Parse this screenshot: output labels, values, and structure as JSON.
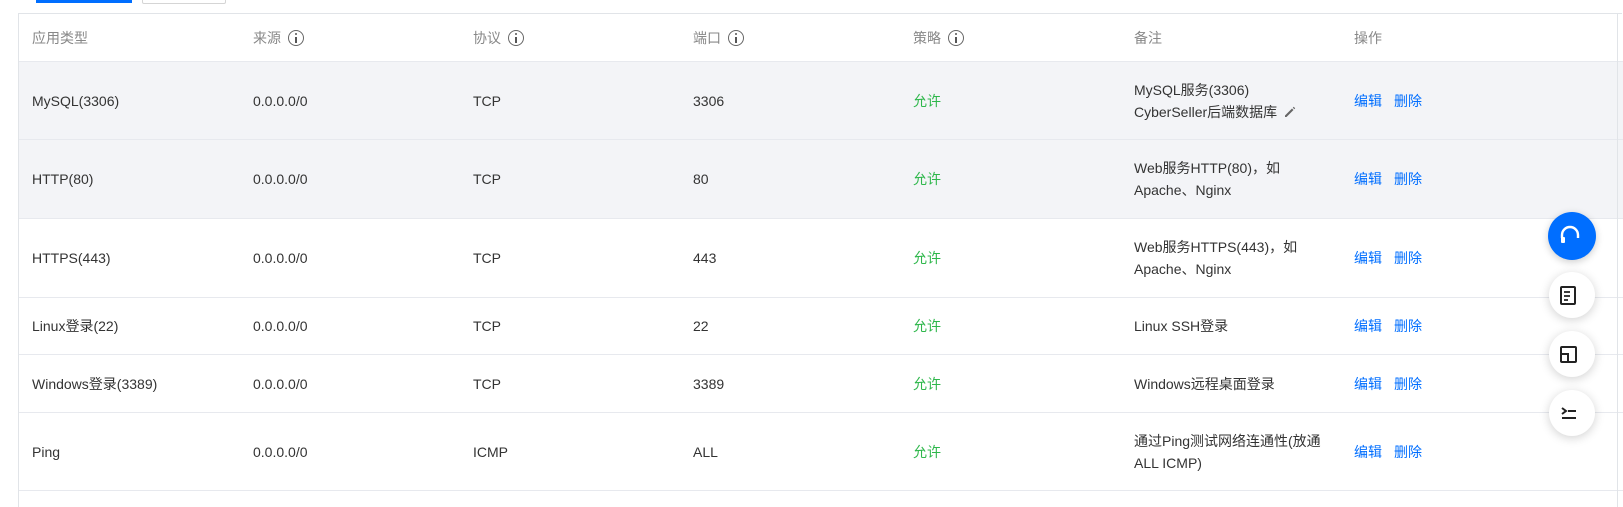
{
  "columns": [
    {
      "label": "应用类型",
      "has_info": false
    },
    {
      "label": "来源",
      "has_info": true
    },
    {
      "label": "协议",
      "has_info": true
    },
    {
      "label": "端口",
      "has_info": true
    },
    {
      "label": "策略",
      "has_info": true
    },
    {
      "label": "备注",
      "has_info": false
    },
    {
      "label": "操作",
      "has_info": false
    }
  ],
  "rows": [
    {
      "type": "MySQL(3306)",
      "source": "0.0.0.0/0",
      "protocol": "TCP",
      "port": "3306",
      "policy": "允许",
      "note_line1": "MySQL服务(3306)",
      "note_line2": "CyberSeller后端数据库",
      "note_editable": true
    },
    {
      "type": "HTTP(80)",
      "source": "0.0.0.0/0",
      "protocol": "TCP",
      "port": "80",
      "policy": "允许",
      "note_line1": "Web服务HTTP(80)，如",
      "note_line2": "Apache、Nginx",
      "note_editable": false
    },
    {
      "type": "HTTPS(443)",
      "source": "0.0.0.0/0",
      "protocol": "TCP",
      "port": "443",
      "policy": "允许",
      "note_line1": "Web服务HTTPS(443)，如",
      "note_line2": "Apache、Nginx",
      "note_editable": false
    },
    {
      "type": "Linux登录(22)",
      "source": "0.0.0.0/0",
      "protocol": "TCP",
      "port": "22",
      "policy": "允许",
      "note_line1": "Linux SSH登录",
      "note_line2": "",
      "note_editable": false
    },
    {
      "type": "Windows登录(3389)",
      "source": "0.0.0.0/0",
      "protocol": "TCP",
      "port": "3389",
      "policy": "允许",
      "note_line1": "Windows远程桌面登录",
      "note_line2": "",
      "note_editable": false
    },
    {
      "type": "Ping",
      "source": "0.0.0.0/0",
      "protocol": "ICMP",
      "port": "ALL",
      "policy": "允许",
      "note_line1": "通过Ping测试网络连通性(放通",
      "note_line2": "ALL ICMP)",
      "note_editable": false
    }
  ],
  "actions": {
    "edit": "编辑",
    "delete": "删除"
  },
  "colors": {
    "primary": "#006eff",
    "allow": "#2eb74b",
    "header_text": "#888888",
    "hover_row": "#f3f4f7"
  },
  "icons": {
    "info": "info-circle-icon",
    "edit_note": "pencil-icon",
    "float_main": "headset-icon",
    "float_1": "document-icon",
    "float_2": "window-icon",
    "float_3": "list-icon"
  }
}
